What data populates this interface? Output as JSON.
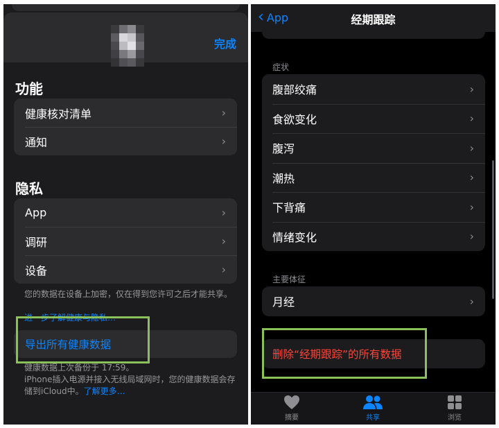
{
  "left": {
    "done_label": "完成",
    "sections": [
      {
        "title": "功能",
        "items": [
          {
            "label": "健康核对清单"
          },
          {
            "label": "通知"
          }
        ]
      },
      {
        "title": "隐私",
        "items": [
          {
            "label": "App"
          },
          {
            "label": "调研"
          },
          {
            "label": "设备"
          }
        ]
      }
    ],
    "privacy_note": "您的数据在设备上加密，仅在得到您许可之后才能共享。",
    "privacy_link": "进一步了解健康与隐私…",
    "export_label": "导出所有健康数据",
    "backup_line1": "健康数据上次备份于 17:59。",
    "backup_line2": "iPhone插入电源并接入无线局域网时，您的健康数据会存储到iCloud中。",
    "learn_more": "了解更多…"
  },
  "right": {
    "back_label": "App",
    "title": "经期跟踪",
    "symptoms_label": "症状",
    "symptoms": [
      {
        "label": "腹部绞痛"
      },
      {
        "label": "食欲变化"
      },
      {
        "label": "腹泻"
      },
      {
        "label": "潮热"
      },
      {
        "label": "下背痛"
      },
      {
        "label": "情绪变化"
      }
    ],
    "vitals_label": "主要体征",
    "vitals": [
      {
        "label": "月经"
      }
    ],
    "delete_label": "删除“经期跟踪”的所有数据",
    "tabs": [
      {
        "label": "摘要",
        "icon": "heart-icon"
      },
      {
        "label": "共享",
        "icon": "people-icon"
      },
      {
        "label": "浏览",
        "icon": "grid-icon"
      }
    ]
  },
  "colors": {
    "accent": "#0a84ff",
    "danger": "#ff453a",
    "highlight": "#8ac15a"
  },
  "chevron": "›"
}
